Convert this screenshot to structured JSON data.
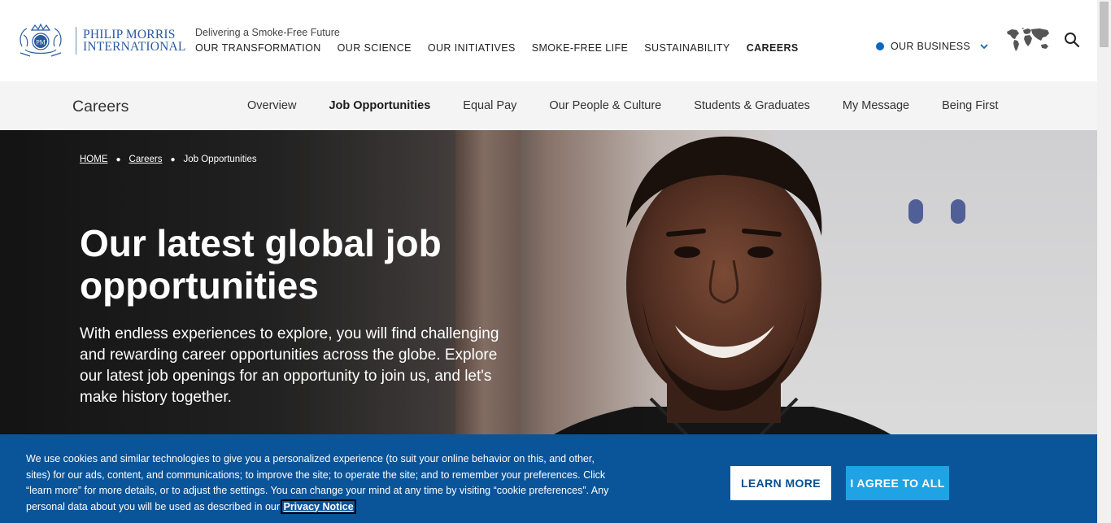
{
  "header": {
    "logo_line1": "PHILIP MORRIS",
    "logo_line2": "INTERNATIONAL",
    "tagline": "Delivering a Smoke-Free Future",
    "nav": [
      {
        "label": "OUR TRANSFORMATION"
      },
      {
        "label": "OUR SCIENCE"
      },
      {
        "label": "OUR INITIATIVES"
      },
      {
        "label": "SMOKE-FREE LIFE"
      },
      {
        "label": "SUSTAINABILITY"
      },
      {
        "label": "CAREERS",
        "active": true
      }
    ],
    "business_label": "OUR BUSINESS",
    "business_chevron": "chevron-down-icon",
    "world_icon": "world-map-icon",
    "search_icon": "search-icon",
    "accent_color": "#0b68c0"
  },
  "subnav": {
    "section_title": "Careers",
    "links": [
      {
        "label": "Overview"
      },
      {
        "label": "Job Opportunities",
        "active": true
      },
      {
        "label": "Equal Pay"
      },
      {
        "label": "Our People & Culture"
      },
      {
        "label": "Students & Graduates"
      },
      {
        "label": "My Message"
      },
      {
        "label": "Being First"
      }
    ]
  },
  "hero": {
    "breadcrumb": [
      {
        "label": "HOME",
        "link": true
      },
      {
        "label": "Careers",
        "link": true
      },
      {
        "label": "Job Opportunities",
        "link": false
      }
    ],
    "title": "Our latest global job opportunities",
    "lead": "With endless experiences to explore, you will find challenging and rewarding career opportunities across the globe. Explore our latest job openings for an opportunity to join us, and let's make history together."
  },
  "cookie_banner": {
    "text_before_link": "We use cookies and similar technologies to give you a personalized experience (to suit your online behavior on this, and other, sites) for our ads, content, and communications; to improve the site; to operate the site; and to remember your preferences. Click “learn more” for more details, or to adjust the settings. You can change your mind at any time by visiting “cookie preferences”. Any personal data about you will be used as described in our ",
    "link_label": "Privacy Notice",
    "learn_more_label": "LEARN MORE",
    "agree_label": "I AGREE TO ALL",
    "background_color": "#0a5499",
    "agree_color": "#1fa3e4"
  }
}
